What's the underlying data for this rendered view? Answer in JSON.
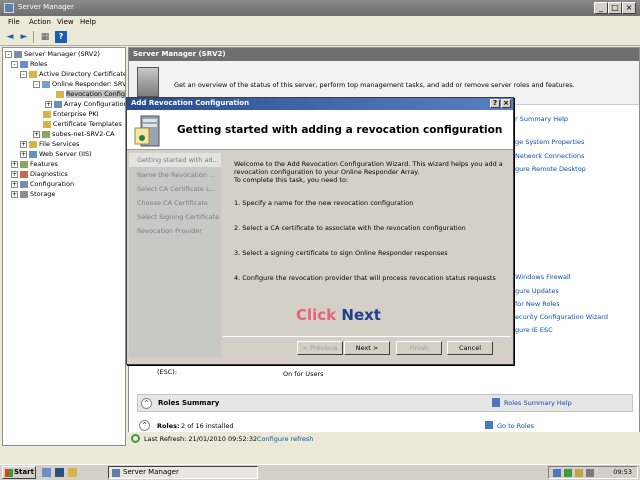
{
  "window": {
    "title": "Server Manager"
  },
  "menu": [
    "File",
    "Action",
    "View",
    "Help"
  ],
  "tree": {
    "items": [
      {
        "label": "Server Manager (SRV2)",
        "level": 0,
        "expander": "-",
        "selected": false
      },
      {
        "label": "Roles",
        "level": 1,
        "expander": "-",
        "selected": false
      },
      {
        "label": "Active Directory Certificate",
        "level": 2,
        "expander": "-",
        "selected": false
      },
      {
        "label": "Online Responder: SRV",
        "level": 3,
        "expander": "-",
        "selected": false
      },
      {
        "label": "Revocation Config",
        "level": 4,
        "expander": "",
        "selected": true
      },
      {
        "label": "Array Configuration",
        "level": 4,
        "expander": "+",
        "selected": false
      },
      {
        "label": "Enterprise PKI",
        "level": 3,
        "expander": "",
        "selected": false
      },
      {
        "label": "Certificate Templates",
        "level": 3,
        "expander": "",
        "selected": false
      },
      {
        "label": "subes-net-SRV2-CA",
        "level": 3,
        "expander": "+",
        "selected": false
      },
      {
        "label": "File Services",
        "level": 2,
        "expander": "+",
        "selected": false
      },
      {
        "label": "Web Server (IIS)",
        "level": 2,
        "expander": "+",
        "selected": false
      },
      {
        "label": "Features",
        "level": 1,
        "expander": "+",
        "selected": false
      },
      {
        "label": "Diagnostics",
        "level": 1,
        "expander": "+",
        "selected": false
      },
      {
        "label": "Configuration",
        "level": 1,
        "expander": "+",
        "selected": false
      },
      {
        "label": "Storage",
        "level": 1,
        "expander": "+",
        "selected": false
      }
    ]
  },
  "content": {
    "header": "Server Manager (SRV2)",
    "banner": "Get an overview of the status of this server, perform top management tasks, and add or remove server roles and features.",
    "summary_help": "r Summary Help",
    "links_top": [
      "ge System Properties",
      "Network Connections",
      "gure Remote Desktop"
    ],
    "links_mid": [
      "Windows Firewall",
      "gure Updates",
      "for New Roles",
      "ecurity Configuration Wizard",
      "gure IE ESC"
    ],
    "esc_label": "(ESC):",
    "esc_value": "On for Users",
    "roles_summary_title": "Roles Summary",
    "roles_summary_help": "Roles Summary Help",
    "roles_count_label": "Roles:",
    "roles_count_value": "2 of 16 installed",
    "go_to_roles": "Go to Roles",
    "last_refresh": "Last Refresh: 21/01/2010 09:52:32",
    "configure_refresh": "Configure refresh"
  },
  "dialog": {
    "title": "Add Revocation Configuration",
    "heading": "Getting started with adding a revocation configuration",
    "nav": [
      {
        "label": "Getting started with ad...",
        "active": true
      },
      {
        "label": "Name the Revocation ...",
        "active": false
      },
      {
        "label": "Select CA Certificate L...",
        "active": false
      },
      {
        "label": "Choose CA Certificate",
        "active": false
      },
      {
        "label": "Select Signing Certificate",
        "active": false
      },
      {
        "label": "Revocation Provider",
        "active": false
      }
    ],
    "intro": "Welcome to the Add Revocation Configuration Wizard. This wizard helps you add a revocation configuration to your Online Responder Array.",
    "intro2": "To complete this task, you need to:",
    "steps": [
      "1. Specify a name for the new revocation configuration",
      "2. Select a CA certificate to associate with the revocation configuration",
      "3. Select a signing certificate to sign Online Responder responses",
      "4. Configure the revocation provider that will process revocation status requests"
    ],
    "buttons": {
      "previous": "< Previous",
      "next": "Next >",
      "finish": "Finish",
      "cancel": "Cancel"
    }
  },
  "callout": {
    "word1": "Click",
    "word2": "Next"
  },
  "taskbar": {
    "start": "Start",
    "task": "Server Manager",
    "time": "09:53"
  },
  "colors": {
    "accent": "#0b4fa8",
    "callout_click": "#e8627c",
    "callout_next": "#1f3f8f"
  }
}
